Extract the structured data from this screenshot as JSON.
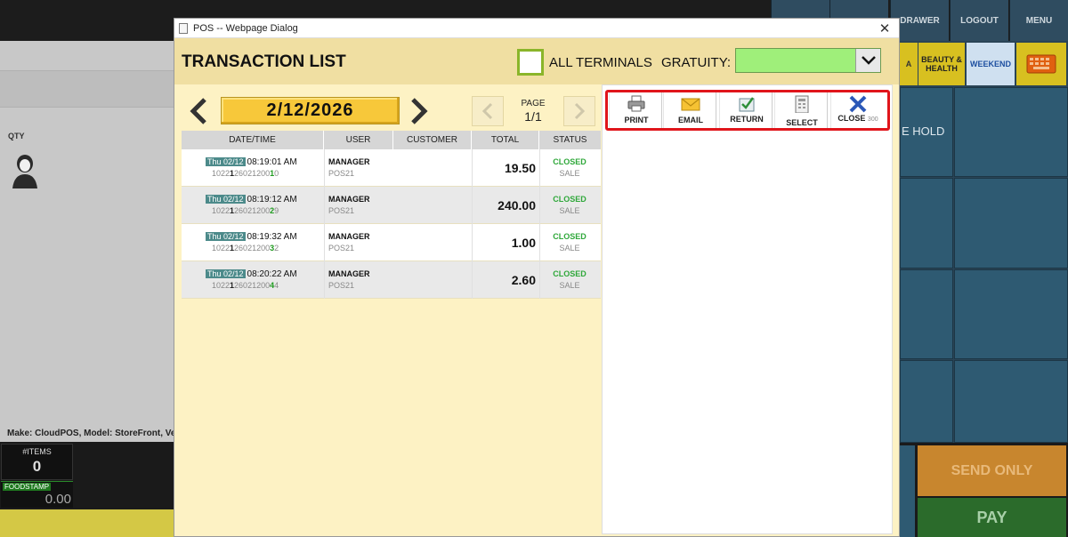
{
  "app": {
    "top_buttons": [
      "DRAWER",
      "LOGOUT",
      "MENU"
    ],
    "categories": [
      {
        "label": "A",
        "bg": "#d8c020",
        "color": "#333"
      },
      {
        "label": "BEAUTY & HEALTH",
        "bg": "#d8c020",
        "color": "#222"
      },
      {
        "label": "WEEKEND",
        "bg": "#cfe0f0",
        "color": "#1d4fa0"
      }
    ],
    "qty_label": "QTY",
    "make_line": "Make: CloudPOS, Model: StoreFront, Ver",
    "items_label": "#ITEMS",
    "items_value": "0",
    "foodstamp_label": "FOODSTAMP",
    "foodstamp_value": "0.00",
    "hold_text": "E HOLD",
    "send_only": "SEND ONLY",
    "pay": "PAY"
  },
  "dialog": {
    "window_title": "POS -- Webpage Dialog",
    "heading": "TRANSACTION LIST",
    "all_terminals_label": "ALL TERMINALS",
    "gratuity_label": "GRATUITY:",
    "gratuity_value": "",
    "date": "2/12/2026",
    "page_label": "PAGE",
    "page_value": "1/1",
    "columns": {
      "datetime": "DATE/TIME",
      "user": "USER",
      "customer": "CUSTOMER",
      "total": "TOTAL",
      "status": "STATUS"
    },
    "rows": [
      {
        "day": "Thu 02/12",
        "time": "08:19:01 AM",
        "id_a": "1022",
        "id_b": "1",
        "id_c": "260212",
        "id_d": "00",
        "id_e": "1",
        "id_f": "0",
        "user": "MANAGER",
        "terminal": "POS21",
        "customer": "",
        "total": "19.50",
        "status": "CLOSED",
        "type": "SALE"
      },
      {
        "day": "Thu 02/12",
        "time": "08:19:12 AM",
        "id_a": "1022",
        "id_b": "1",
        "id_c": "260212",
        "id_d": "00",
        "id_e": "2",
        "id_f": "9",
        "user": "MANAGER",
        "terminal": "POS21",
        "customer": "",
        "total": "240.00",
        "status": "CLOSED",
        "type": "SALE"
      },
      {
        "day": "Thu 02/12",
        "time": "08:19:32 AM",
        "id_a": "1022",
        "id_b": "1",
        "id_c": "260212",
        "id_d": "00",
        "id_e": "3",
        "id_f": "2",
        "user": "MANAGER",
        "terminal": "POS21",
        "customer": "",
        "total": "1.00",
        "status": "CLOSED",
        "type": "SALE"
      },
      {
        "day": "Thu 02/12",
        "time": "08:20:22 AM",
        "id_a": "1022",
        "id_b": "1",
        "id_c": "260212",
        "id_d": "00",
        "id_e": "4",
        "id_f": "4",
        "user": "MANAGER",
        "terminal": "POS21",
        "customer": "",
        "total": "2.60",
        "status": "CLOSED",
        "type": "SALE"
      }
    ],
    "toolbar": {
      "print": "PRINT",
      "email": "EMAIL",
      "return": "RETURN",
      "select": "SELECT",
      "close": "CLOSE",
      "close_count": "300"
    }
  },
  "colors": {
    "dialog_bg": "#fdf2c4",
    "date_bg": "#f7c83a",
    "gratuity_bg": "#9fef7a",
    "status_closed": "#2fa83a",
    "highlight_frame": "#e0151b"
  }
}
